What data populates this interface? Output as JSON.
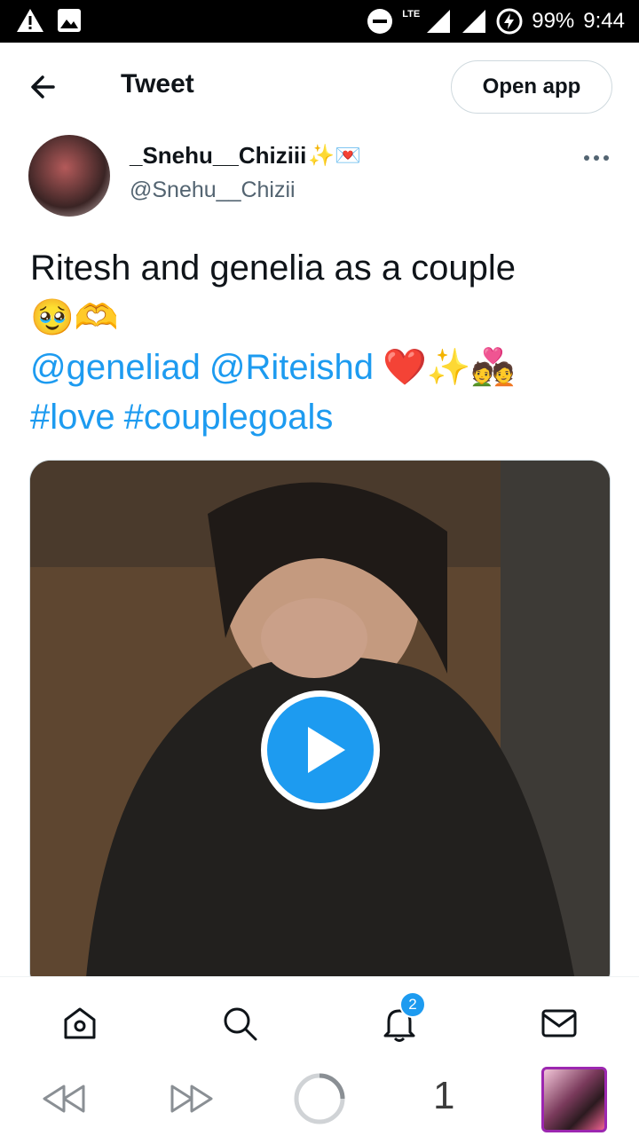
{
  "status_bar": {
    "network": "LTE",
    "battery": "99%",
    "time": "9:44"
  },
  "header": {
    "title": "Tweet",
    "open_app_label": "Open app"
  },
  "author": {
    "name": "_Snehu__Chiziii",
    "name_emojis": "✨💌",
    "handle": "@Snehu__Chizii"
  },
  "tweet": {
    "line1": "Ritesh and genelia as a couple",
    "line2_emojis": "🥹🫶",
    "mentions": [
      {
        "text": "@geneliad"
      },
      {
        "text": "@Riteishd"
      }
    ],
    "line3_emojis": "❤️✨💑",
    "hashtags": [
      {
        "text": "#love"
      },
      {
        "text": "#couplegoals"
      }
    ]
  },
  "media": {
    "type": "video",
    "play_icon": "play-icon"
  },
  "tab_bar": {
    "items": [
      {
        "name": "home",
        "icon": "home-icon"
      },
      {
        "name": "search",
        "icon": "search-icon"
      },
      {
        "name": "notifications",
        "icon": "bell-icon",
        "badge": "2"
      },
      {
        "name": "messages",
        "icon": "mail-icon"
      }
    ]
  },
  "browser_nav": {
    "back_icon": "rewind-icon",
    "forward_icon": "fast-forward-icon",
    "reload_icon": "loading-icon",
    "tab_count": "1"
  },
  "colors": {
    "accent": "#1d9bf0",
    "text": "#0f1419",
    "secondary": "#536471"
  }
}
